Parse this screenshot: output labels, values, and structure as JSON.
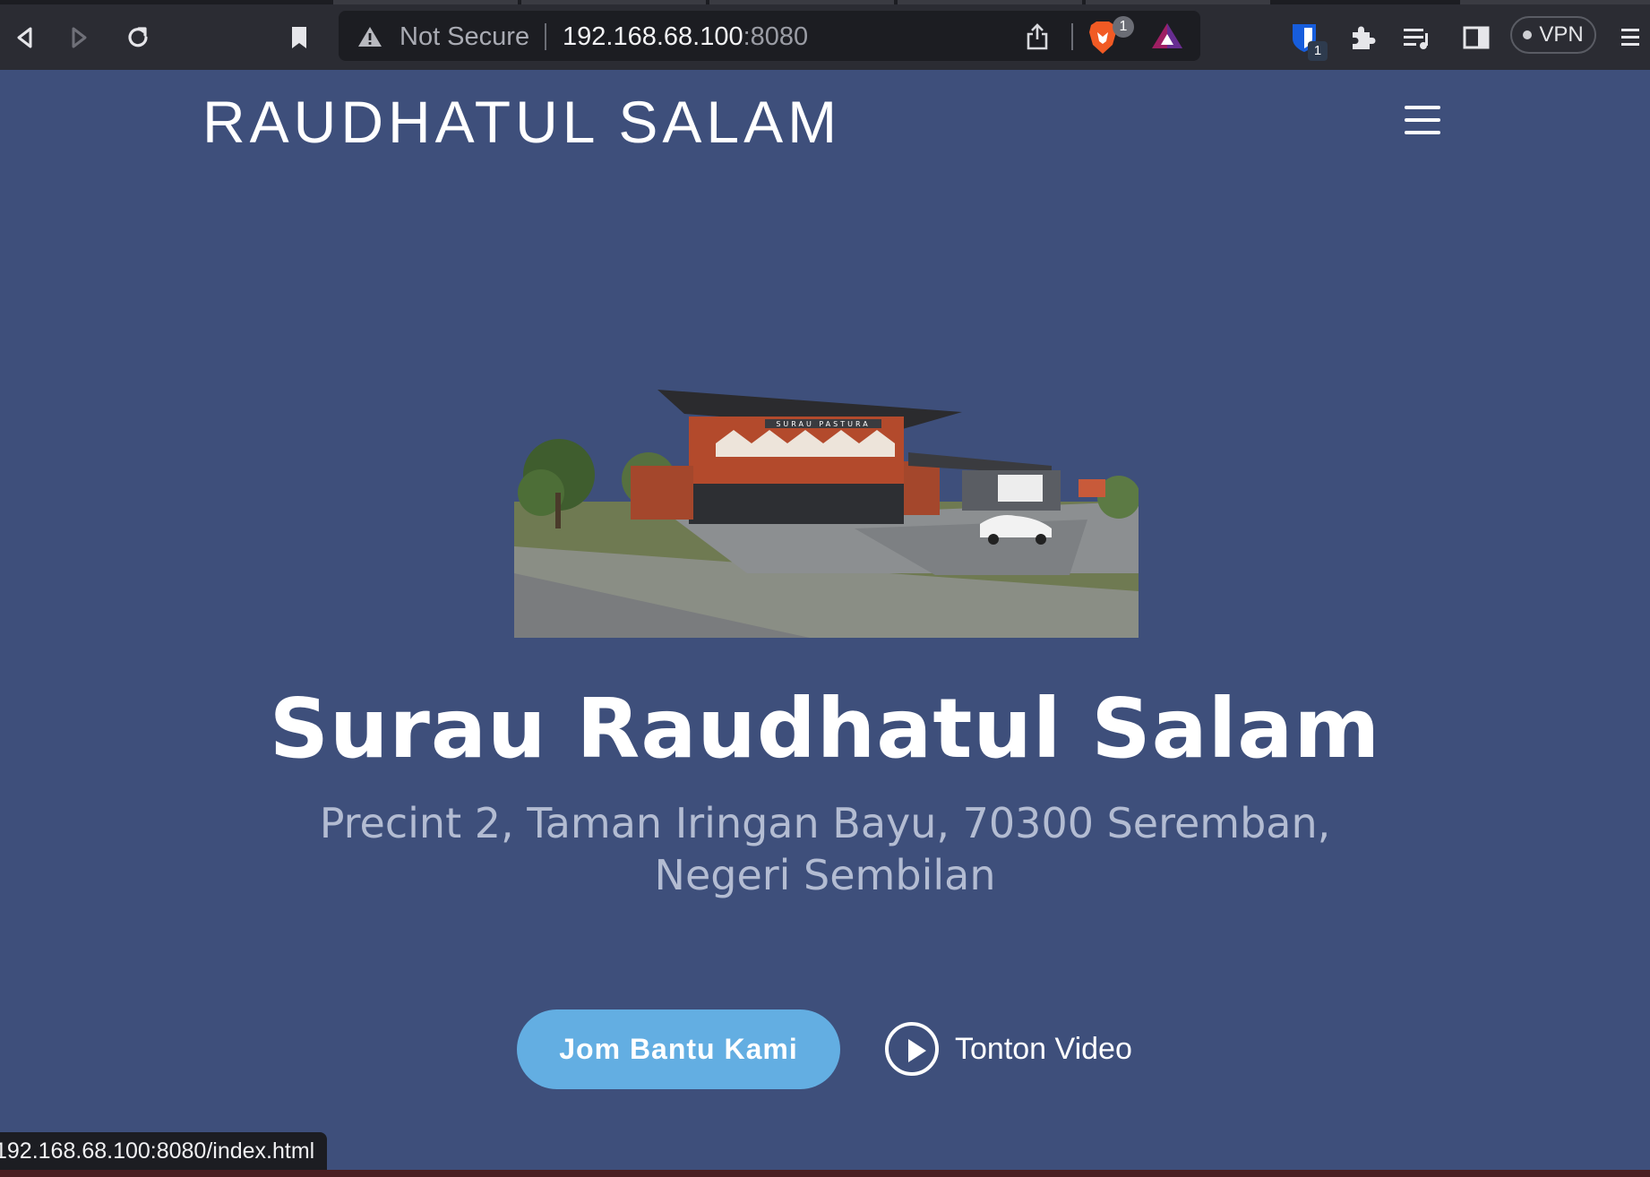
{
  "browser": {
    "security_label": "Not Secure",
    "url_host": "192.168.68.100",
    "url_port": ":8080",
    "brave_badge_count": "1",
    "bitwarden_badge_count": "1",
    "vpn_label": "VPN",
    "status_url": "192.168.68.100:8080/index.html",
    "icons": [
      "back-icon",
      "forward-icon",
      "reload-icon",
      "bookmark-icon",
      "warning-icon",
      "share-icon",
      "brave-shield-icon",
      "bat-rewards-icon",
      "bitwarden-icon",
      "extensions-icon",
      "playlist-icon",
      "sidebar-icon",
      "menu-icon"
    ]
  },
  "site": {
    "brand": "RAUDHATUL SALAM",
    "hero": {
      "image_alt": "Rendering of the surau building",
      "building_sign": "SURAU PASTURA",
      "title": "Surau Raudhatul Salam",
      "address": "Precint 2, Taman Iringan Bayu, 70300 Seremban, Negeri Sembilan",
      "cta_label": "Jom Bantu Kami",
      "video_label": "Tonton Video"
    }
  },
  "colors": {
    "page_bg": "#3e4f7b",
    "cta_bg": "#63aee2",
    "subtitle": "#b3bcd2"
  }
}
